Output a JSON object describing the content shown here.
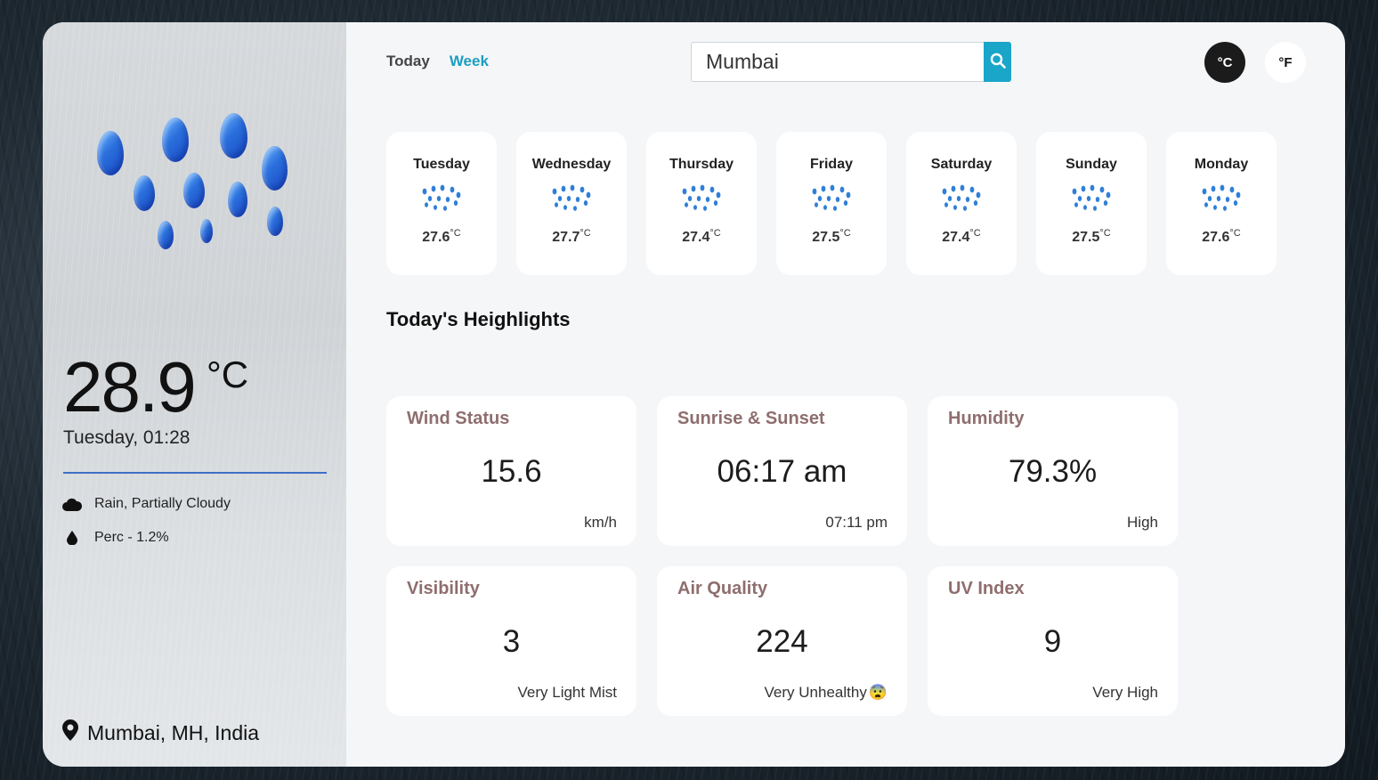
{
  "current": {
    "temperature": "28.9",
    "unit_symbol": "°C",
    "date_time": "Tuesday, 01:28",
    "condition": "Rain, Partially Cloudy",
    "precipitation": "Perc - 1.2%",
    "location": "Mumbai, MH, India",
    "weather_icon": "rain-drops-icon"
  },
  "nav": {
    "today_label": "Today",
    "week_label": "Week"
  },
  "search": {
    "value": "Mumbai",
    "button_icon": "search-icon"
  },
  "units": {
    "celsius_label": "°C",
    "fahrenheit_label": "°F"
  },
  "forecast": [
    {
      "day": "Tuesday",
      "temp": "27.6",
      "unit": "°C",
      "icon": "rain-icon"
    },
    {
      "day": "Wednesday",
      "temp": "27.7",
      "unit": "°C",
      "icon": "rain-icon"
    },
    {
      "day": "Thursday",
      "temp": "27.4",
      "unit": "°C",
      "icon": "rain-icon"
    },
    {
      "day": "Friday",
      "temp": "27.5",
      "unit": "°C",
      "icon": "rain-icon"
    },
    {
      "day": "Saturday",
      "temp": "27.4",
      "unit": "°C",
      "icon": "rain-icon"
    },
    {
      "day": "Sunday",
      "temp": "27.5",
      "unit": "°C",
      "icon": "rain-icon"
    },
    {
      "day": "Monday",
      "temp": "27.6",
      "unit": "°C",
      "icon": "rain-icon"
    }
  ],
  "highlights_title": "Today's Heighlights",
  "highlights": [
    {
      "title": "Wind Status",
      "value": "15.6",
      "sub": "km/h"
    },
    {
      "title": "Sunrise & Sunset",
      "value": "06:17 am",
      "sub": "07:11 pm"
    },
    {
      "title": "Humidity",
      "value": "79.3%",
      "sub": "High"
    },
    {
      "title": "Visibility",
      "value": "3",
      "sub": "Very Light Mist"
    },
    {
      "title": "Air Quality",
      "value": "224",
      "sub": "Very Unhealthy",
      "emoji": "😨"
    },
    {
      "title": "UV Index",
      "value": "9",
      "sub": "Very High"
    }
  ],
  "colors": {
    "accent": "#1aa6c9",
    "highlight_title": "#8f6e6e",
    "divider": "#3e6fc6"
  }
}
